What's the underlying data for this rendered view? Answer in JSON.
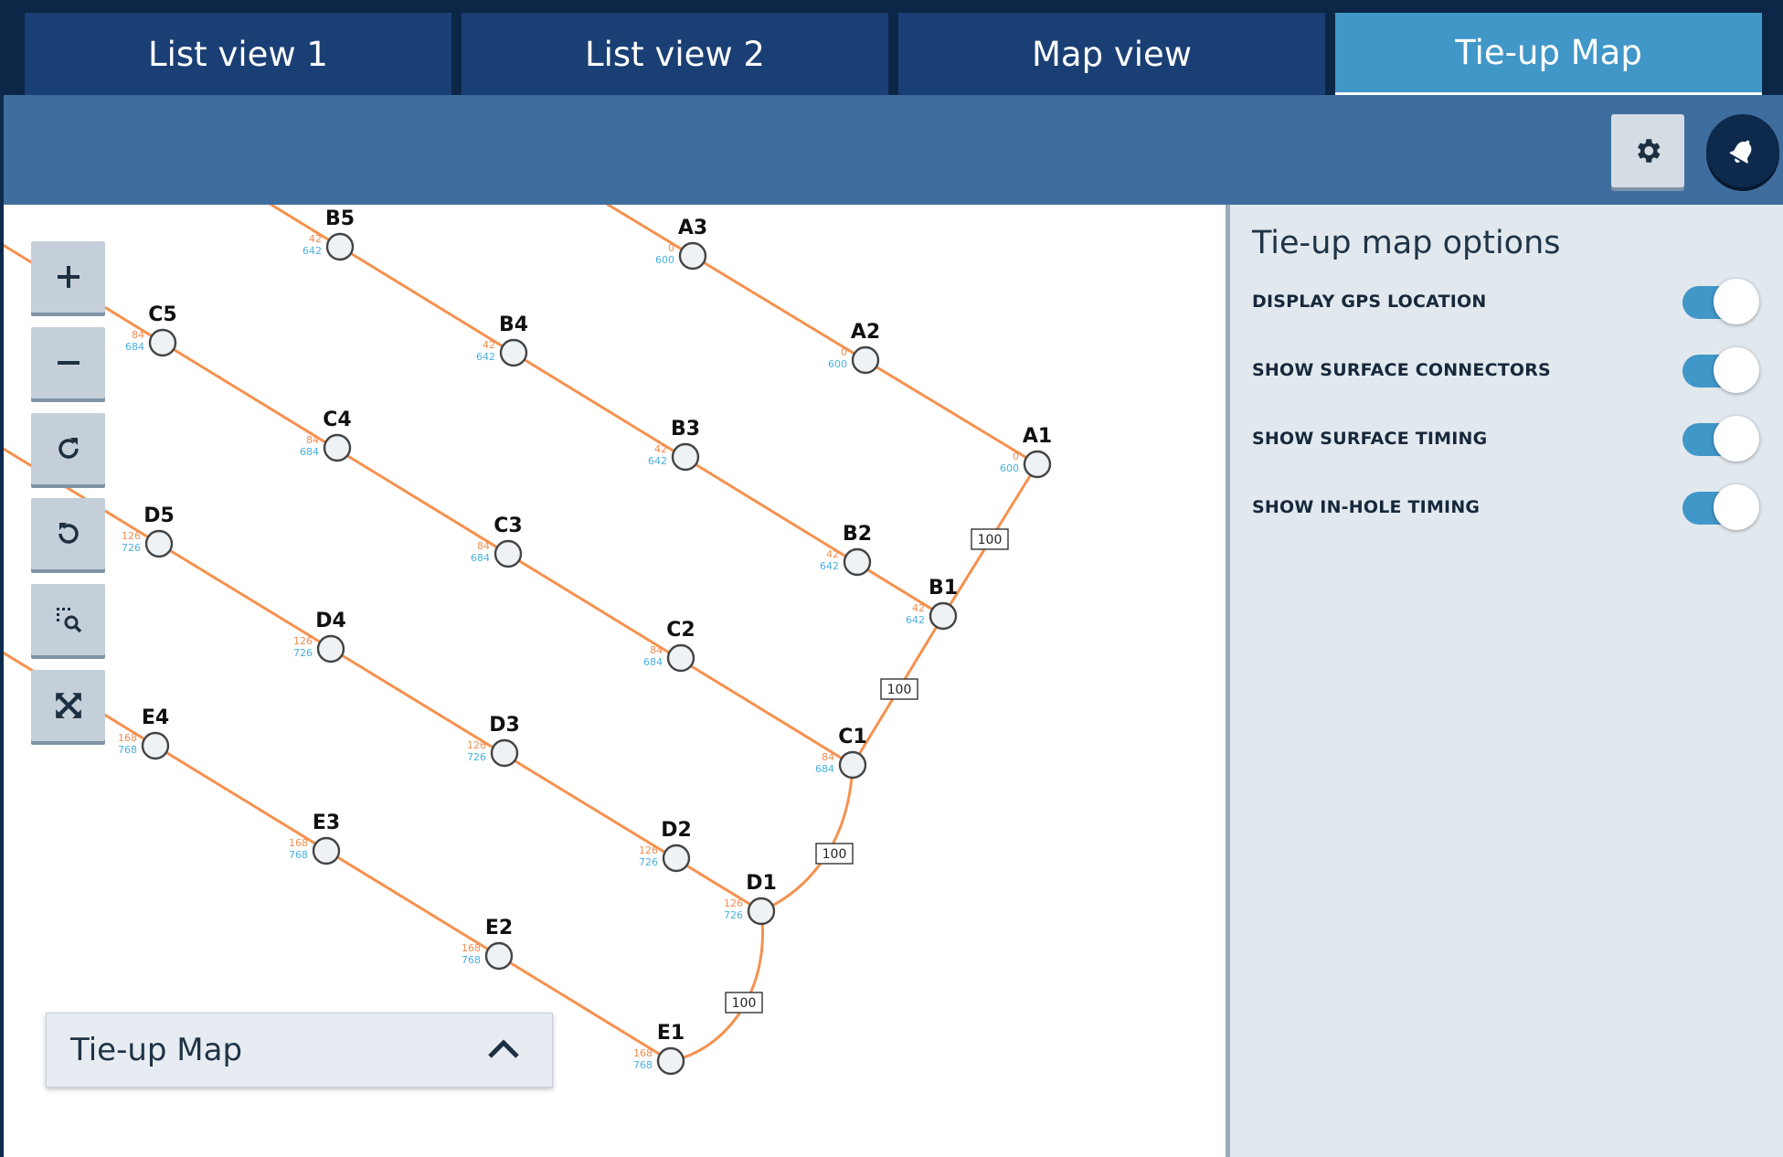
{
  "tabs": [
    {
      "label": "List view 1",
      "active": false
    },
    {
      "label": "List view 2",
      "active": false
    },
    {
      "label": "Map view",
      "active": false
    },
    {
      "label": "Tie-up Map",
      "active": true
    }
  ],
  "toolbar": {
    "settings_icon": "gear-icon",
    "notification_icon": "bell-icon"
  },
  "map_controls": [
    {
      "name": "zoom-in",
      "icon": "plus-icon"
    },
    {
      "name": "zoom-out",
      "icon": "minus-icon"
    },
    {
      "name": "rotate-clockwise",
      "icon": "rotate-cw-icon"
    },
    {
      "name": "rotate-counterclockwise",
      "icon": "rotate-ccw-icon"
    },
    {
      "name": "zoom-to-selection",
      "icon": "zoom-select-icon"
    },
    {
      "name": "fit-to-screen",
      "icon": "expand-icon"
    }
  ],
  "options_panel": {
    "title": "Tie-up map options",
    "options": [
      {
        "label": "DISPLAY GPS LOCATION",
        "enabled": true
      },
      {
        "label": "SHOW SURFACE CONNECTORS",
        "enabled": true
      },
      {
        "label": "SHOW SURFACE TIMING",
        "enabled": true
      },
      {
        "label": "SHOW IN-HOLE TIMING",
        "enabled": true
      }
    ]
  },
  "map_panel": {
    "title": "Tie-up Map",
    "chevron_icon": "chevron-up-icon"
  },
  "colors": {
    "connector": "#f5914e",
    "surface_timing": "#f08c4e",
    "in_hole_timing": "#4ab0e0",
    "accent": "#4197c8"
  },
  "holes": [
    {
      "id": "A1",
      "surface": "0",
      "inhole": "600"
    },
    {
      "id": "A2",
      "surface": "0",
      "inhole": "600"
    },
    {
      "id": "A3",
      "surface": "0",
      "inhole": "600"
    },
    {
      "id": "B1",
      "surface": "42",
      "inhole": "642"
    },
    {
      "id": "B2",
      "surface": "42",
      "inhole": "642"
    },
    {
      "id": "B3",
      "surface": "42",
      "inhole": "642"
    },
    {
      "id": "B4",
      "surface": "42",
      "inhole": "642"
    },
    {
      "id": "B5",
      "surface": "42",
      "inhole": "642"
    },
    {
      "id": "C1",
      "surface": "84",
      "inhole": "684"
    },
    {
      "id": "C2",
      "surface": "84",
      "inhole": "684"
    },
    {
      "id": "C3",
      "surface": "84",
      "inhole": "684"
    },
    {
      "id": "C4",
      "surface": "84",
      "inhole": "684"
    },
    {
      "id": "C5",
      "surface": "84",
      "inhole": "684"
    },
    {
      "id": "D1",
      "surface": "126",
      "inhole": "726"
    },
    {
      "id": "D2",
      "surface": "126",
      "inhole": "726"
    },
    {
      "id": "D3",
      "surface": "126",
      "inhole": "726"
    },
    {
      "id": "D4",
      "surface": "126",
      "inhole": "726"
    },
    {
      "id": "D5",
      "surface": "126",
      "inhole": "726"
    },
    {
      "id": "E1",
      "surface": "168",
      "inhole": "768"
    },
    {
      "id": "E2",
      "surface": "168",
      "inhole": "768"
    },
    {
      "id": "E3",
      "surface": "168",
      "inhole": "768"
    },
    {
      "id": "E4",
      "surface": "168",
      "inhole": "768"
    }
  ],
  "trunk_delays": [
    {
      "from": "A1",
      "to": "B1",
      "label": "100"
    },
    {
      "from": "B1",
      "to": "C1",
      "label": "100"
    },
    {
      "from": "C1",
      "to": "D1",
      "label": "100"
    },
    {
      "from": "D1",
      "to": "E1",
      "label": "100"
    }
  ]
}
